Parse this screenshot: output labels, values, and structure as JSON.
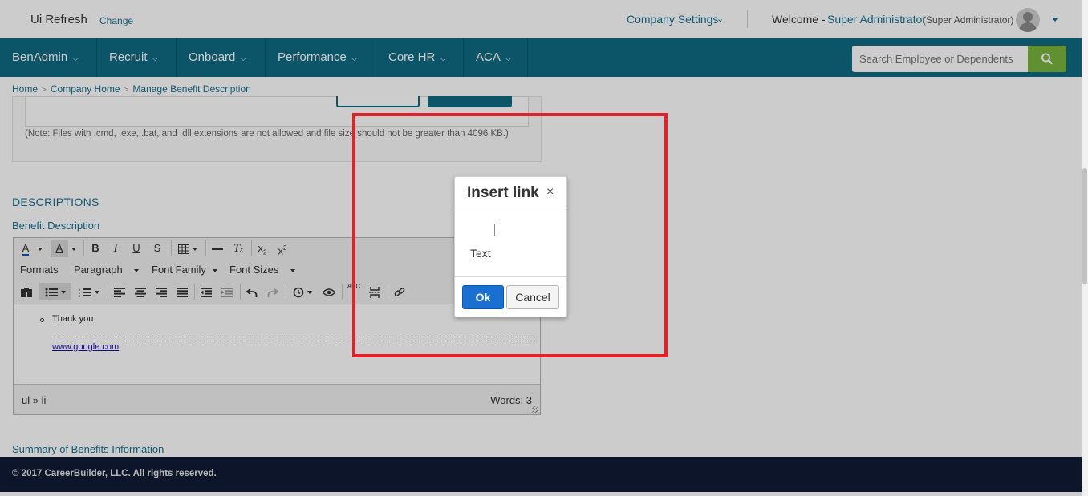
{
  "header": {
    "app_title": "Ui Refresh",
    "change_label": "Change",
    "company_settings_label": "Company Settings",
    "welcome_label": "Welcome -",
    "admin_name": "Super Administrator",
    "admin_role": "(Super Administrator)"
  },
  "nav": {
    "items": [
      {
        "label": "BenAdmin"
      },
      {
        "label": "Recruit"
      },
      {
        "label": "Onboard"
      },
      {
        "label": "Performance"
      },
      {
        "label": "Core HR"
      },
      {
        "label": "ACA"
      }
    ],
    "search_placeholder": "Search Employee or Dependents"
  },
  "breadcrumb": {
    "items": [
      "Home",
      "Company Home",
      "Manage Benefit Description"
    ]
  },
  "upload": {
    "note": "(Note: Files with .cmd, .exe, .bat, and .dll extensions are not allowed and file size should not be greater than 4096 KB.)"
  },
  "descriptions": {
    "section_title": "DESCRIPTIONS",
    "benefit_label": "Benefit Description",
    "summary_label": "Summary of Benefits Information"
  },
  "editor": {
    "toolbar": {
      "formats_label": "Formats",
      "paragraph_label": "Paragraph",
      "font_family_label": "Font Family",
      "font_sizes_label": "Font Sizes"
    },
    "content": {
      "list_item": "Thank you",
      "link": "www.google.com"
    },
    "status": {
      "path": "ul » li",
      "words": "Words: 3"
    }
  },
  "dialog": {
    "title": "Insert link",
    "close_glyph": "×",
    "text_label": "Text",
    "ok_label": "Ok",
    "cancel_label": "Cancel"
  },
  "footer": {
    "copyright": "© 2017 CareerBuilder, LLC. All rights reserved."
  },
  "colors": {
    "nav_bg": "#0f6983",
    "accent_link": "#1a6e8e",
    "search_btn": "#79b53e",
    "footer_bg": "#0f1b35",
    "highlight": "#e0222a",
    "ok_button": "#1a70d0"
  }
}
